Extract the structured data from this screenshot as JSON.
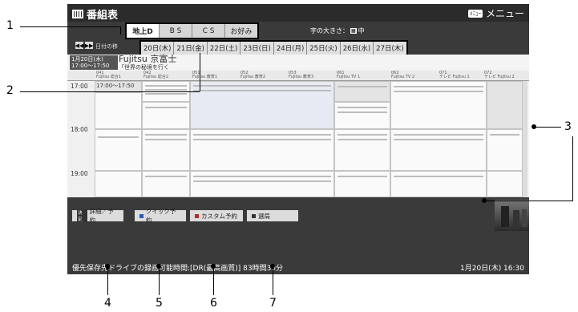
{
  "header": {
    "title": "番組表",
    "menu_label": "メニュー",
    "menu_key": "ﾒﾆｭｰ"
  },
  "tabs": [
    {
      "label": "地上D",
      "active": true
    },
    {
      "label": "B S"
    },
    {
      "label": "C S"
    },
    {
      "label": "お好み"
    }
  ],
  "size_label": "字の大きさ：",
  "size_key": "▦",
  "size_value": "中",
  "date_nav_label": "日付の移",
  "dates": [
    "20日(木)",
    "21日(金)",
    "22日(土)",
    "23日(日)",
    "24日(月)",
    "25日(火)",
    "26日(水)",
    "27日(木)"
  ],
  "selected_program": {
    "date": "1月20日(木)",
    "time": "17:00～17:50",
    "title": "Fujitsu  京富士",
    "desc": "「世界の秘境を行く"
  },
  "channels": [
    {
      "no": "041",
      "name": "Fujitsu 総合1"
    },
    {
      "no": "042",
      "name": "Fujitsu 総合2"
    },
    {
      "no": "051",
      "name": "Fujitsu 教育1"
    },
    {
      "no": "052",
      "name": "Fujitsu 教育2"
    },
    {
      "no": "053",
      "name": "Fujitsu 教育3"
    },
    {
      "no": "061",
      "name": "Fujitsu TV 1"
    },
    {
      "no": "062",
      "name": "Fujitsu TV 2"
    },
    {
      "no": "071",
      "name": "テレビ Fujitsu 1"
    },
    {
      "no": "072",
      "name": "テレビ Fujitsu 2"
    }
  ],
  "times": [
    "17:00",
    "18:00",
    "19:00"
  ],
  "first_program_time": "17:00～17:50",
  "buttons": {
    "detail": {
      "key": "決定",
      "label": "詳細／予約"
    },
    "quick": {
      "label": "クイック予約"
    },
    "custom": {
      "label": "カスタム予約"
    },
    "select": {
      "label": "選局"
    }
  },
  "status": {
    "text": "優先保存先ドライブの録画可能時間:[DR(最高画質)] 83時間39分",
    "datetime": "1月20日(木) 16:30"
  },
  "callouts": [
    "1",
    "2",
    "3",
    "4",
    "5",
    "6",
    "7"
  ]
}
